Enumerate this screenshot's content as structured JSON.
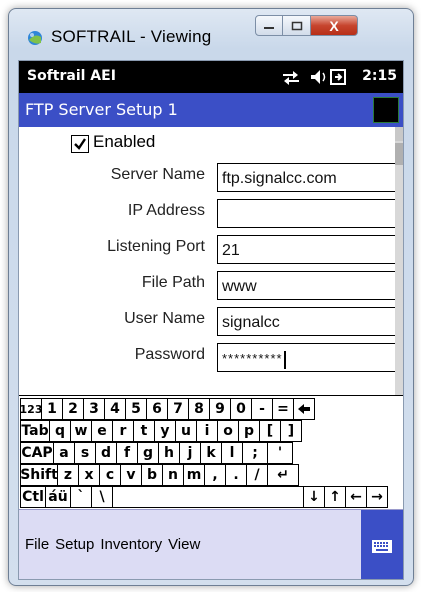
{
  "window": {
    "title": "SOFTRAIL - Viewing",
    "buttons": {
      "close": "X"
    }
  },
  "status_bar": {
    "title": "Softrail AEI",
    "time": "2:15"
  },
  "screen": {
    "title": "FTP Server Setup 1"
  },
  "form": {
    "enabled": {
      "label": "Enabled",
      "checked": true
    },
    "fields": [
      {
        "label": "Server Name",
        "value": "ftp.signalcc.com"
      },
      {
        "label": "IP Address",
        "value": ""
      },
      {
        "label": "Listening Port",
        "value": "21"
      },
      {
        "label": "File Path",
        "value": "www"
      },
      {
        "label": "User Name",
        "value": "signalcc"
      },
      {
        "label": "Password",
        "value": "**********"
      }
    ]
  },
  "keyboard": {
    "rows": [
      [
        "123",
        "1",
        "2",
        "3",
        "4",
        "5",
        "6",
        "7",
        "8",
        "9",
        "0",
        "-",
        "=",
        "◆"
      ],
      [
        "Tab",
        "q",
        "w",
        "e",
        "r",
        "t",
        "y",
        "u",
        "i",
        "o",
        "p",
        "[",
        "]"
      ],
      [
        "CAP",
        "a",
        "s",
        "d",
        "f",
        "g",
        "h",
        "j",
        "k",
        "l",
        ";",
        "'"
      ],
      [
        "Shift",
        "z",
        "x",
        "c",
        "v",
        "b",
        "n",
        "m",
        ",",
        ".",
        "/",
        "↵"
      ],
      [
        "Ctl",
        "áü",
        "`",
        "\\",
        "",
        "↓",
        "↑",
        "←",
        "→"
      ]
    ]
  },
  "menu": {
    "items": [
      "File",
      "Setup",
      "Inventory",
      "View"
    ]
  },
  "colors": {
    "accent": "#3b4fc6",
    "status_bar": "#000000",
    "menu_bg": "#dcdcf4"
  }
}
